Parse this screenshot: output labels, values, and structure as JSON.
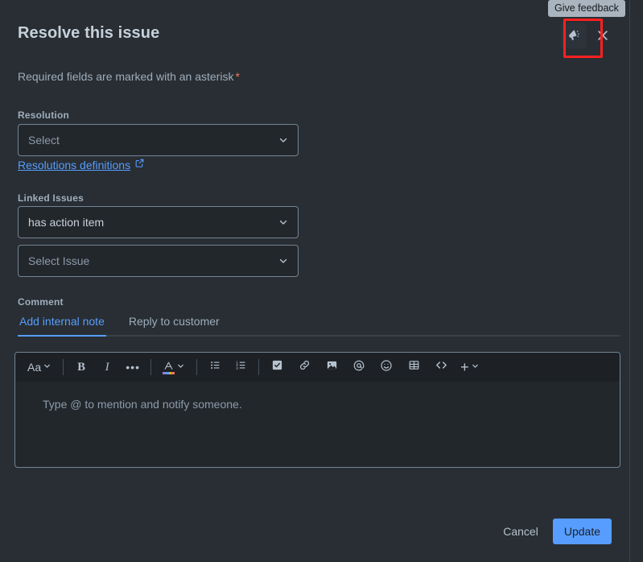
{
  "modal": {
    "title": "Resolve this issue",
    "required_note": "Required fields are marked with an asterisk",
    "required_asterisk": "*"
  },
  "header": {
    "tooltip": "Give feedback",
    "feedback_icon": "megaphone-icon",
    "close_icon": "close-icon"
  },
  "fields": {
    "resolution": {
      "label": "Resolution",
      "placeholder": "Select",
      "link_text": "Resolutions definitions",
      "link_icon": "external-link-icon"
    },
    "linked_issues": {
      "label": "Linked Issues",
      "link_type_value": "has action item",
      "issue_placeholder": "Select Issue"
    },
    "comment": {
      "label": "Comment",
      "tabs": [
        {
          "label": "Add internal note",
          "selected": true
        },
        {
          "label": "Reply to customer",
          "selected": false
        }
      ],
      "editor_placeholder": "Type @ to mention and notify someone."
    }
  },
  "toolbar": {
    "items": [
      {
        "name": "text-style-icon",
        "label": "Aa"
      },
      {
        "name": "bold-icon",
        "label": "B"
      },
      {
        "name": "italic-icon",
        "label": "I"
      },
      {
        "name": "more-formatting-icon",
        "label": "•••"
      },
      {
        "name": "text-color-icon",
        "label": "A"
      },
      {
        "name": "bullet-list-icon",
        "label": ""
      },
      {
        "name": "numbered-list-icon",
        "label": ""
      },
      {
        "name": "task-list-icon",
        "label": ""
      },
      {
        "name": "link-icon",
        "label": ""
      },
      {
        "name": "image-icon",
        "label": ""
      },
      {
        "name": "mention-icon",
        "label": "@"
      },
      {
        "name": "emoji-icon",
        "label": ""
      },
      {
        "name": "table-icon",
        "label": ""
      },
      {
        "name": "code-icon",
        "label": "<>"
      },
      {
        "name": "insert-more-icon",
        "label": "+"
      }
    ]
  },
  "footer": {
    "cancel_label": "Cancel",
    "update_label": "Update"
  },
  "colors": {
    "accent": "#579dff",
    "panel": "#282e33",
    "input": "#22272b",
    "toolbar": "#1d2125",
    "border": "#738496",
    "text": "#b6c2cf",
    "muted": "#9fadbc",
    "required": "#f87462",
    "highlight": "#ff2020",
    "tooltip_bg": "#a9b4bf"
  }
}
